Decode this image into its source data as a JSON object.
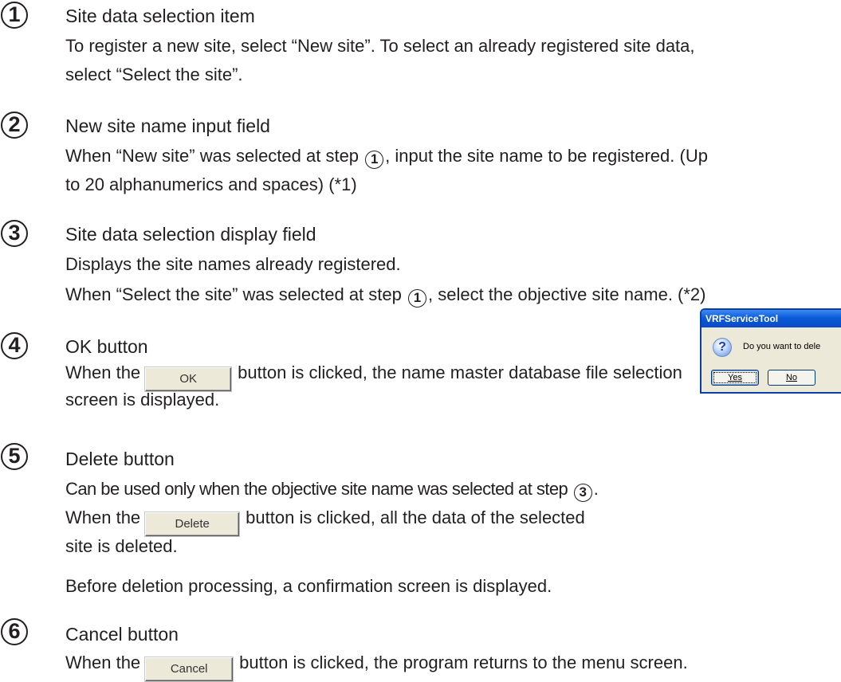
{
  "items": [
    {
      "number": "1",
      "title": "Site data selection item",
      "lines": [
        "To register a new site, select “New site”. To select an already registered site data,",
        "select “Select the site”."
      ]
    },
    {
      "number": "2",
      "title": "New site name input field",
      "line1_before": "When “New site” was selected at step",
      "line1_ref": "1",
      "line1_after": ", input the site name to be registered. (Up",
      "line2": "to 20 alphanumerics and spaces) (*1)"
    },
    {
      "number": "3",
      "title": "Site data selection display field",
      "line1": "Displays the site names already registered.",
      "line2_before": "When “Select the site” was selected at step",
      "line2_ref": "1",
      "line2_after": ", select the objective site name. (*2)"
    },
    {
      "number": "4",
      "title": "OK button",
      "line1_before": "When the",
      "button_label": "OK",
      "line1_after": "button is clicked, the name master database file selection",
      "line2": "screen is displayed."
    },
    {
      "number": "5",
      "title": "Delete button",
      "line1_before": "Can be used only when the objective site name was selected at step",
      "line1_ref": "3",
      "line1_after": ".",
      "line2_before": "When the",
      "button_label": "Delete",
      "line2_after": "button is clicked, all the data of the selected",
      "line3": "site is deleted.",
      "line4": "Before deletion processing, a confirmation screen is displayed."
    },
    {
      "number": "6",
      "title": "Cancel button",
      "line1_before": "When the",
      "button_label": "Cancel",
      "line1_after": "button is clicked, the program returns to the menu screen."
    }
  ],
  "dialog": {
    "title": "VRFServiceTool",
    "icon": "question-icon",
    "message": "Do you want to dele",
    "yes_label": "Yes",
    "no_label": "No"
  }
}
